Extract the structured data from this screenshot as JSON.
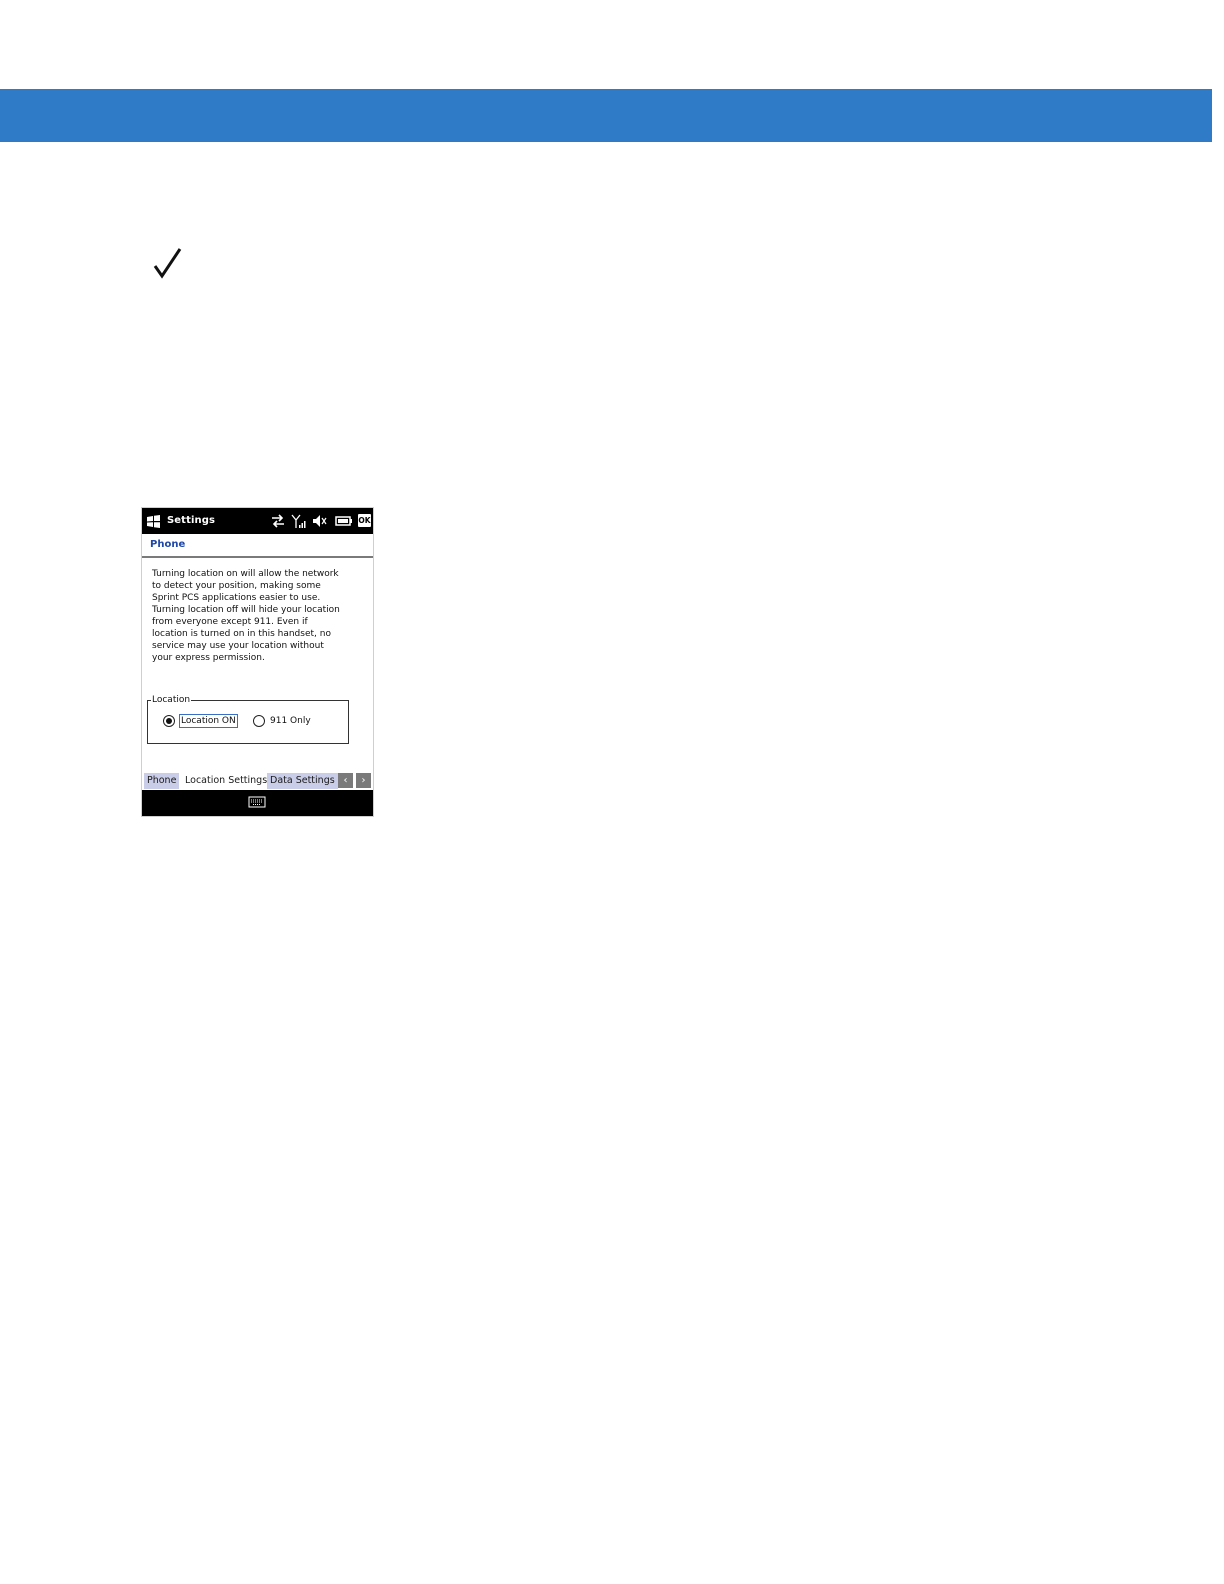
{
  "colors": {
    "header_band": "#2f7bc8",
    "header_link": "#1f48a8",
    "tab_inactive": "#c9cde8"
  },
  "note_icon": "checkmark-icon",
  "device": {
    "status_bar": {
      "title": "Settings",
      "icons": [
        "windows-start-icon",
        "data-connection-icon",
        "signal-strength-icon",
        "speaker-muted-icon",
        "battery-icon"
      ],
      "ok_label": "OK"
    },
    "header": {
      "title": "Phone"
    },
    "description": [
      "Turning location on will allow the network",
      "to detect your position, making some",
      "Sprint PCS applications easier to use.",
      "Turning location off will hide your location",
      "from everyone except 911.  Even if",
      "location is turned on in this handset, no",
      "service may use your location without",
      "your express permission."
    ],
    "location_group": {
      "label": "Location",
      "options": [
        {
          "label": "Location ON",
          "selected": true
        },
        {
          "label": "911 Only",
          "selected": false
        }
      ]
    },
    "tabs": [
      {
        "label": "Phone",
        "active": false
      },
      {
        "label": "Location Settings",
        "active": true
      },
      {
        "label": "Data Settings",
        "active": false
      }
    ],
    "scroll_arrows": [
      "chevron-left-icon",
      "chevron-right-icon"
    ],
    "softkey_icon": "keyboard-icon"
  }
}
